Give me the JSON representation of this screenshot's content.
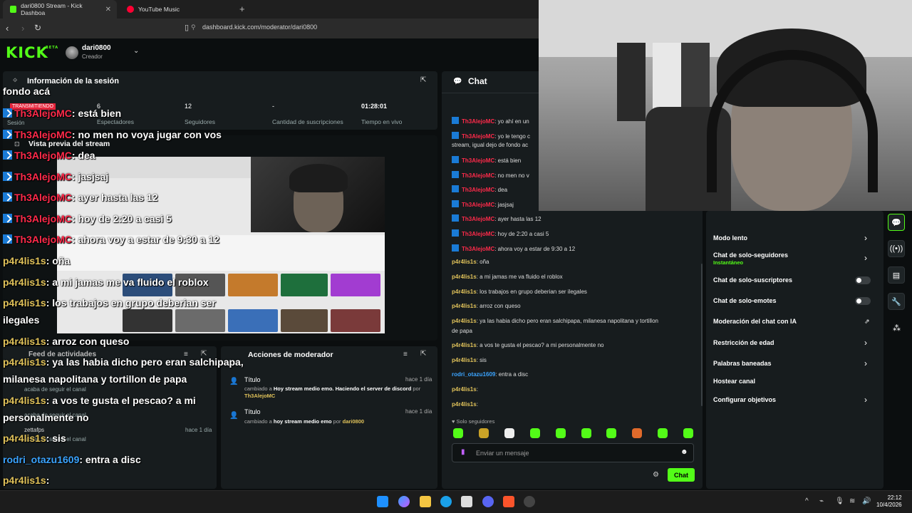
{
  "browser": {
    "tabs": [
      {
        "label": "dari0800 Stream - Kick Dashboa",
        "favicon_color": "#53fc18"
      },
      {
        "label": "YouTube Music",
        "favicon_color": "#ff0033"
      }
    ],
    "url": "dashboard.kick.com/moderator/dari0800"
  },
  "header": {
    "logo": "KICK",
    "logo_tag": "BETA",
    "username": "dari0800",
    "role": "Creador"
  },
  "session": {
    "title": "Información de la sesión",
    "badge": "TRANSMITIENDO",
    "session_label": "Sesión",
    "viewers_value": "6",
    "viewers_label": "Espectadores",
    "followers_value": "12",
    "followers_label": "Seguidores",
    "subs_value": "-",
    "subs_label": "Cantidad de suscripciones",
    "time_value": "01:28:01",
    "time_label": "Tiempo en vivo"
  },
  "preview": {
    "title": "Vista previa del stream"
  },
  "activity": {
    "title": "Feed de actividades",
    "entries": [
      {
        "text": "acaba de seguir el canal"
      },
      {
        "text": "acaba de seguir el canal"
      },
      {
        "user": "zettafps",
        "time": "hace 1 día"
      },
      {
        "text": "acaba de seguir el canal"
      }
    ]
  },
  "modactions": {
    "title": "Acciones de moderador",
    "items": [
      {
        "label": "Título",
        "time": "hace 1 día",
        "prefix": "cambiado a",
        "value": "Hoy stream medio emo. Haciendo el server de discord",
        "by_prefix": "por",
        "by": "Th3AlejoMC"
      },
      {
        "label": "Título",
        "time": "hace 1 día",
        "prefix": "cambiado a",
        "value": "hoy stream medio emo",
        "by_prefix": "por",
        "by": "dari0800"
      }
    ]
  },
  "overlay_chat": [
    {
      "user": "",
      "text": "fondo acá",
      "color": "none",
      "badge": false
    },
    {
      "user": "Th3AlejoMC",
      "text": ": está bien",
      "color": "red",
      "badge": true
    },
    {
      "user": "Th3AlejoMC",
      "text": ": no men no voya jugar con vos",
      "color": "red",
      "badge": true
    },
    {
      "user": "Th3AlejoMC",
      "text": ": dea",
      "color": "red",
      "badge": true
    },
    {
      "user": "Th3AlejoMC",
      "text": ": jasjsaj",
      "color": "red",
      "badge": true
    },
    {
      "user": "Th3AlejoMC",
      "text": ": ayer hasta las 12",
      "color": "red",
      "badge": true
    },
    {
      "user": "Th3AlejoMC",
      "text": ": hoy de 2:20 a casi 5",
      "color": "red",
      "badge": true
    },
    {
      "user": "Th3AlejoMC",
      "text": ": ahora voy a estar de 9:30 a 12",
      "color": "red",
      "badge": true
    },
    {
      "user": "p4r4lis1s",
      "text": ": oña",
      "color": "gold",
      "badge": false
    },
    {
      "user": "p4r4lis1s",
      "text": ": a mi jamas me va fluido el roblox",
      "color": "gold",
      "badge": false
    },
    {
      "user": "p4r4lis1s",
      "text": ": los trabajos en grupo deberian ser",
      "color": "gold",
      "badge": false
    },
    {
      "user": "",
      "text": "ilegales",
      "color": "none",
      "badge": false
    },
    {
      "user": "p4r4lis1s",
      "text": ": arroz con queso",
      "color": "gold",
      "badge": false
    },
    {
      "user": "p4r4lis1s",
      "text": ": ya las habia dicho pero eran salchipapa,",
      "color": "gold",
      "badge": false
    },
    {
      "user": "",
      "text": "milanesa napolitana y tortillon de papa",
      "color": "none",
      "badge": false
    },
    {
      "user": "p4r4lis1s",
      "text": ": a vos te gusta el pescao? a mi",
      "color": "gold",
      "badge": false
    },
    {
      "user": "",
      "text": "personalmente no",
      "color": "none",
      "badge": false
    },
    {
      "user": "p4r4lis1s",
      "text": ": sis",
      "color": "gold",
      "badge": false
    },
    {
      "user": "rodri_otazu1609",
      "text": ": entra a disc",
      "color": "blue",
      "badge": false
    },
    {
      "user": "p4r4lis1s",
      "text": ":",
      "color": "gold",
      "badge": false
    },
    {
      "user": "p4r4lis1s",
      "text": ":",
      "color": "gold",
      "badge": false
    }
  ],
  "chat": {
    "title": "Chat",
    "messages": [
      {
        "user": "Th3AlejoMC",
        "text": ": yo ahí en un",
        "color": "red",
        "badge": true
      },
      {
        "user": "Th3AlejoMC",
        "text": ": yo le tengo c",
        "color": "red",
        "badge": true
      },
      {
        "user": "",
        "text": "stream, igual dejo de fondo ac",
        "color": "none",
        "badge": false
      },
      {
        "user": "Th3AlejoMC",
        "text": ": está bien",
        "color": "red",
        "badge": true
      },
      {
        "user": "Th3AlejoMC",
        "text": ": no men no v",
        "color": "red",
        "badge": true
      },
      {
        "user": "Th3AlejoMC",
        "text": ": dea",
        "color": "red",
        "badge": true
      },
      {
        "user": "Th3AlejoMC",
        "text": ": jasjsaj",
        "color": "red",
        "badge": true
      },
      {
        "user": "Th3AlejoMC",
        "text": ": ayer hasta las 12",
        "color": "red",
        "badge": true
      },
      {
        "user": "Th3AlejoMC",
        "text": ": hoy de 2:20 a casi 5",
        "color": "red",
        "badge": true
      },
      {
        "user": "Th3AlejoMC",
        "text": ": ahora voy a estar de 9:30 a 12",
        "color": "red",
        "badge": true
      },
      {
        "user": "p4r4lis1s",
        "text": ": oña",
        "color": "gold",
        "badge": false
      },
      {
        "user": "p4r4lis1s",
        "text": ": a mi jamas me va fluido el roblox",
        "color": "gold",
        "badge": false
      },
      {
        "user": "p4r4lis1s",
        "text": ": los trabajos en grupo deberian ser ilegales",
        "color": "gold",
        "badge": false
      },
      {
        "user": "p4r4lis1s",
        "text": ": arroz con queso",
        "color": "gold",
        "badge": false
      },
      {
        "user": "p4r4lis1s",
        "text": ": ya las habia dicho pero eran salchipapa, milanesa napolitana y tortillon",
        "color": "gold",
        "badge": false
      },
      {
        "user": "",
        "text": "de papa",
        "color": "none",
        "badge": false
      },
      {
        "user": "p4r4lis1s",
        "text": ": a vos te gusta el pescao? a mi personalmente no",
        "color": "gold",
        "badge": false
      },
      {
        "user": "p4r4lis1s",
        "text": ": sis",
        "color": "gold",
        "badge": false
      },
      {
        "user": "rodri_otazu1609",
        "text": ": entra a disc",
        "color": "blue",
        "badge": false
      },
      {
        "user": "p4r4lis1s",
        "text": ":",
        "color": "gold",
        "badge": false
      },
      {
        "user": "p4r4lis1s",
        "text": ":",
        "color": "gold",
        "badge": false
      }
    ],
    "followers_only_note": "Solo seguidores",
    "input_placeholder": "Enviar un mensaje",
    "send_label": "Chat"
  },
  "settings": {
    "items": [
      {
        "label": "Modo lento",
        "control": "arrow",
        "sub": ""
      },
      {
        "label": "Chat de solo-seguidores",
        "control": "arrow",
        "sub": "Instantáneo"
      },
      {
        "label": "Chat de solo-suscriptores",
        "control": "toggle",
        "sub": ""
      },
      {
        "label": "Chat de solo-emotes",
        "control": "toggle",
        "sub": ""
      },
      {
        "label": "Moderación del chat con IA",
        "control": "external",
        "sub": ""
      },
      {
        "label": "Restricción de edad",
        "control": "arrow",
        "sub": ""
      },
      {
        "label": "Palabras baneadas",
        "control": "arrow",
        "sub": ""
      },
      {
        "label": "Hostear canal",
        "control": "none",
        "sub": ""
      },
      {
        "label": "Configurar objetivos",
        "control": "arrow",
        "sub": ""
      }
    ]
  },
  "taskbar": {
    "time": "22:12",
    "date": "10/4/2026"
  },
  "colors": {
    "kick_green": "#53fc18",
    "bg": "#0b0e0f",
    "panel": "#171c1e",
    "red_user": "#ff2a4a",
    "gold_user": "#e0c25a",
    "blue_user": "#3ba4ff"
  }
}
